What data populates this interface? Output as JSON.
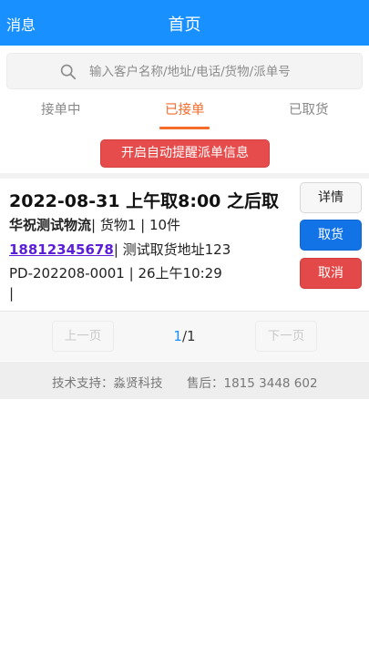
{
  "header": {
    "left_label": "消息",
    "title": "首页"
  },
  "search": {
    "placeholder": "输入客户名称/地址/电话/货物/派单号",
    "icon": "search-icon"
  },
  "tabs": [
    {
      "label": "接单中",
      "active": false
    },
    {
      "label": "已接单",
      "active": true
    },
    {
      "label": "已取货",
      "active": false
    }
  ],
  "remind_button": "开启自动提醒派单信息",
  "order": {
    "headline": "2022-08-31 上午取8:00 之后取",
    "customer": "华祝测试物流",
    "goods_suffix": "| 货物1 | 10件",
    "phone": "18812345678",
    "address_suffix": "| 测试取货地址123",
    "order_line": "PD-202208-0001 | 26上午10:29",
    "note": "|",
    "buttons": {
      "detail": "详情",
      "pickup": "取货",
      "cancel": "取消"
    }
  },
  "pager": {
    "prev": "上一页",
    "current": "1",
    "total_text": "/1",
    "next": "下一页"
  },
  "footer": {
    "support": "技术支持：淼贤科技",
    "after_sales": "售后：1815 3448 602"
  },
  "colors": {
    "primary": "#1890ff",
    "accent_orange": "#f56b2a",
    "danger": "#e34949",
    "pickup_blue": "#1273e6",
    "phone_purple": "#5b1ed8"
  }
}
